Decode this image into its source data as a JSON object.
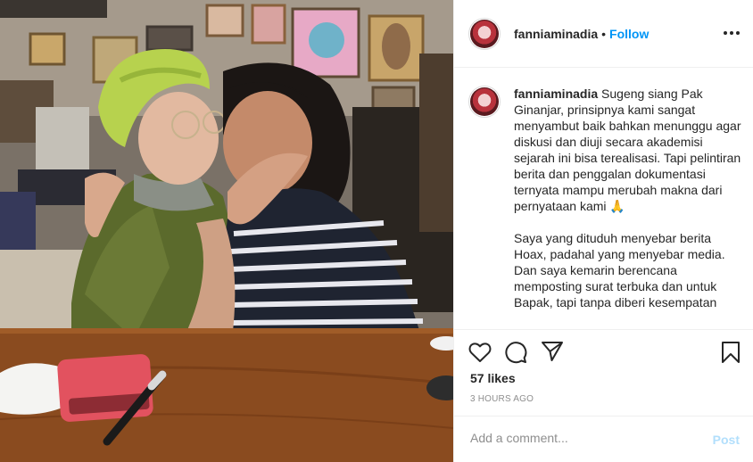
{
  "post": {
    "username": "fanniaminadia",
    "separator": "•",
    "follow_label": "Follow",
    "caption_username": "fanniaminadia",
    "caption_text": "Sugeng siang Pak Ginanjar, prinsipnya kami sangat menyambut baik bahkan menunggu agar diskusi dan diuji secara akademisi sejarah ini bisa terealisasi. Tapi pelintiran berita dan penggalan dokumentasi ternyata mampu merubah makna dari pernyataan kami 🙏\n\nSaya yang dituduh menyebar berita Hoax, padahal yang menyebar media. Dan saya kemarin berencana memposting surat terbuka dan untuk Bapak, tapi tanpa diberi kesempatan",
    "likes": "57 likes",
    "time": "3 HOURS AGO",
    "comment_placeholder": "Add a comment...",
    "post_label": "Post"
  },
  "icons": {
    "more": "more-options-icon",
    "like": "heart-icon",
    "comment": "comment-bubble-icon",
    "share": "share-paper-plane-icon",
    "save": "bookmark-icon"
  },
  "colors": {
    "link": "#0095f6",
    "post_disabled": "#b2dffc",
    "muted": "#8e8e8e",
    "text": "#262626"
  }
}
